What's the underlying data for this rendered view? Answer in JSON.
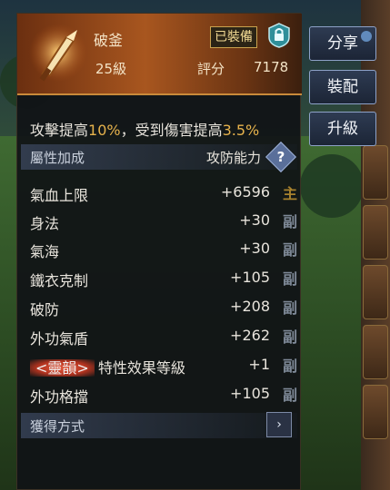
{
  "item": {
    "name": "破釜",
    "equipped_label": "已裝備",
    "level": "25級",
    "score_label": "評分",
    "score_value": "7178",
    "icon": "blade-icon"
  },
  "effect": {
    "prefix": "攻擊提高",
    "value1": "10%",
    "middle": "，受到傷害提高",
    "value2": "3.5%"
  },
  "attributes": {
    "title": "屬性加成",
    "right_label": "攻防能力",
    "help_label": "?",
    "stats": [
      {
        "name": "氣血上限",
        "value": "+6596",
        "tag": "主"
      },
      {
        "name": "身法",
        "value": "+30",
        "tag": "副"
      },
      {
        "name": "氣海",
        "value": "+30",
        "tag": "副"
      },
      {
        "name": "鐵衣克制",
        "value": "+105",
        "tag": "副"
      },
      {
        "name": "破防",
        "value": "+208",
        "tag": "副"
      },
      {
        "name": "外功氣盾",
        "value": "+262",
        "tag": "副"
      },
      {
        "name": "特性效果等級",
        "prefix": "<靈韻>",
        "value": "+1",
        "tag": "副"
      },
      {
        "name": "外功格擋",
        "value": "+105",
        "tag": "副"
      }
    ]
  },
  "source": {
    "title": "獲得方式",
    "arrow": "›"
  },
  "buttons": {
    "share": "分享",
    "equip": "裝配",
    "upgrade": "升級"
  },
  "colors": {
    "accent": "#c98a3a",
    "highlight": "#e7b34c",
    "main_tag": "#a8822e",
    "sub_tag": "#7f8a98"
  }
}
